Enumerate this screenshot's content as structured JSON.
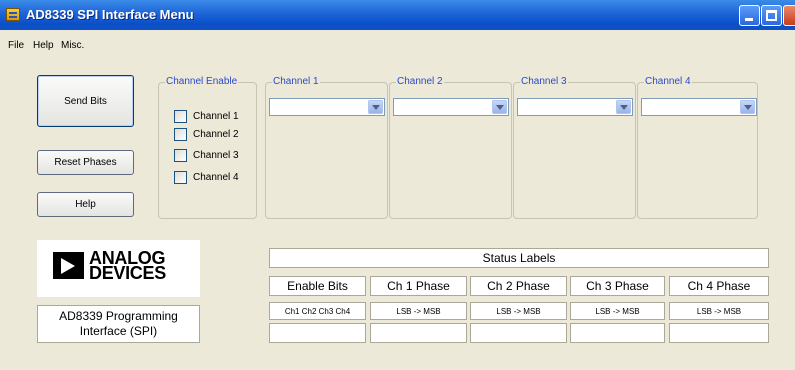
{
  "window": {
    "title": "AD8339 SPI Interface Menu"
  },
  "menu": [
    "File",
    "Help",
    "Misc."
  ],
  "buttons": {
    "send": "Send Bits",
    "reset": "Reset Phases",
    "help": "Help"
  },
  "channel_enable": {
    "title": "Channel Enable",
    "items": [
      {
        "label": "Channel 1",
        "checked": false
      },
      {
        "label": "Channel 2",
        "checked": false
      },
      {
        "label": "Channel 3",
        "checked": false
      },
      {
        "label": "Channel 4",
        "checked": false
      }
    ]
  },
  "channels": [
    {
      "title": "Channel 1",
      "value": ""
    },
    {
      "title": "Channel 2",
      "value": ""
    },
    {
      "title": "Channel 3",
      "value": ""
    },
    {
      "title": "Channel 4",
      "value": ""
    }
  ],
  "logo": {
    "line1": "ANALOG",
    "line2": "DEVICES"
  },
  "program": {
    "line1": "AD8339 Programming",
    "line2": "Interface (SPI)"
  },
  "status": {
    "title": "Status Labels",
    "headers": [
      "Enable Bits",
      "Ch 1 Phase",
      "Ch 2 Phase",
      "Ch 3 Phase",
      "Ch 4 Phase"
    ],
    "values": [
      "Ch1 Ch2 Ch3 Ch4",
      "LSB -> MSB",
      "LSB -> MSB",
      "LSB -> MSB",
      "LSB -> MSB"
    ],
    "bottom": [
      "",
      "",
      "",
      "",
      ""
    ]
  }
}
